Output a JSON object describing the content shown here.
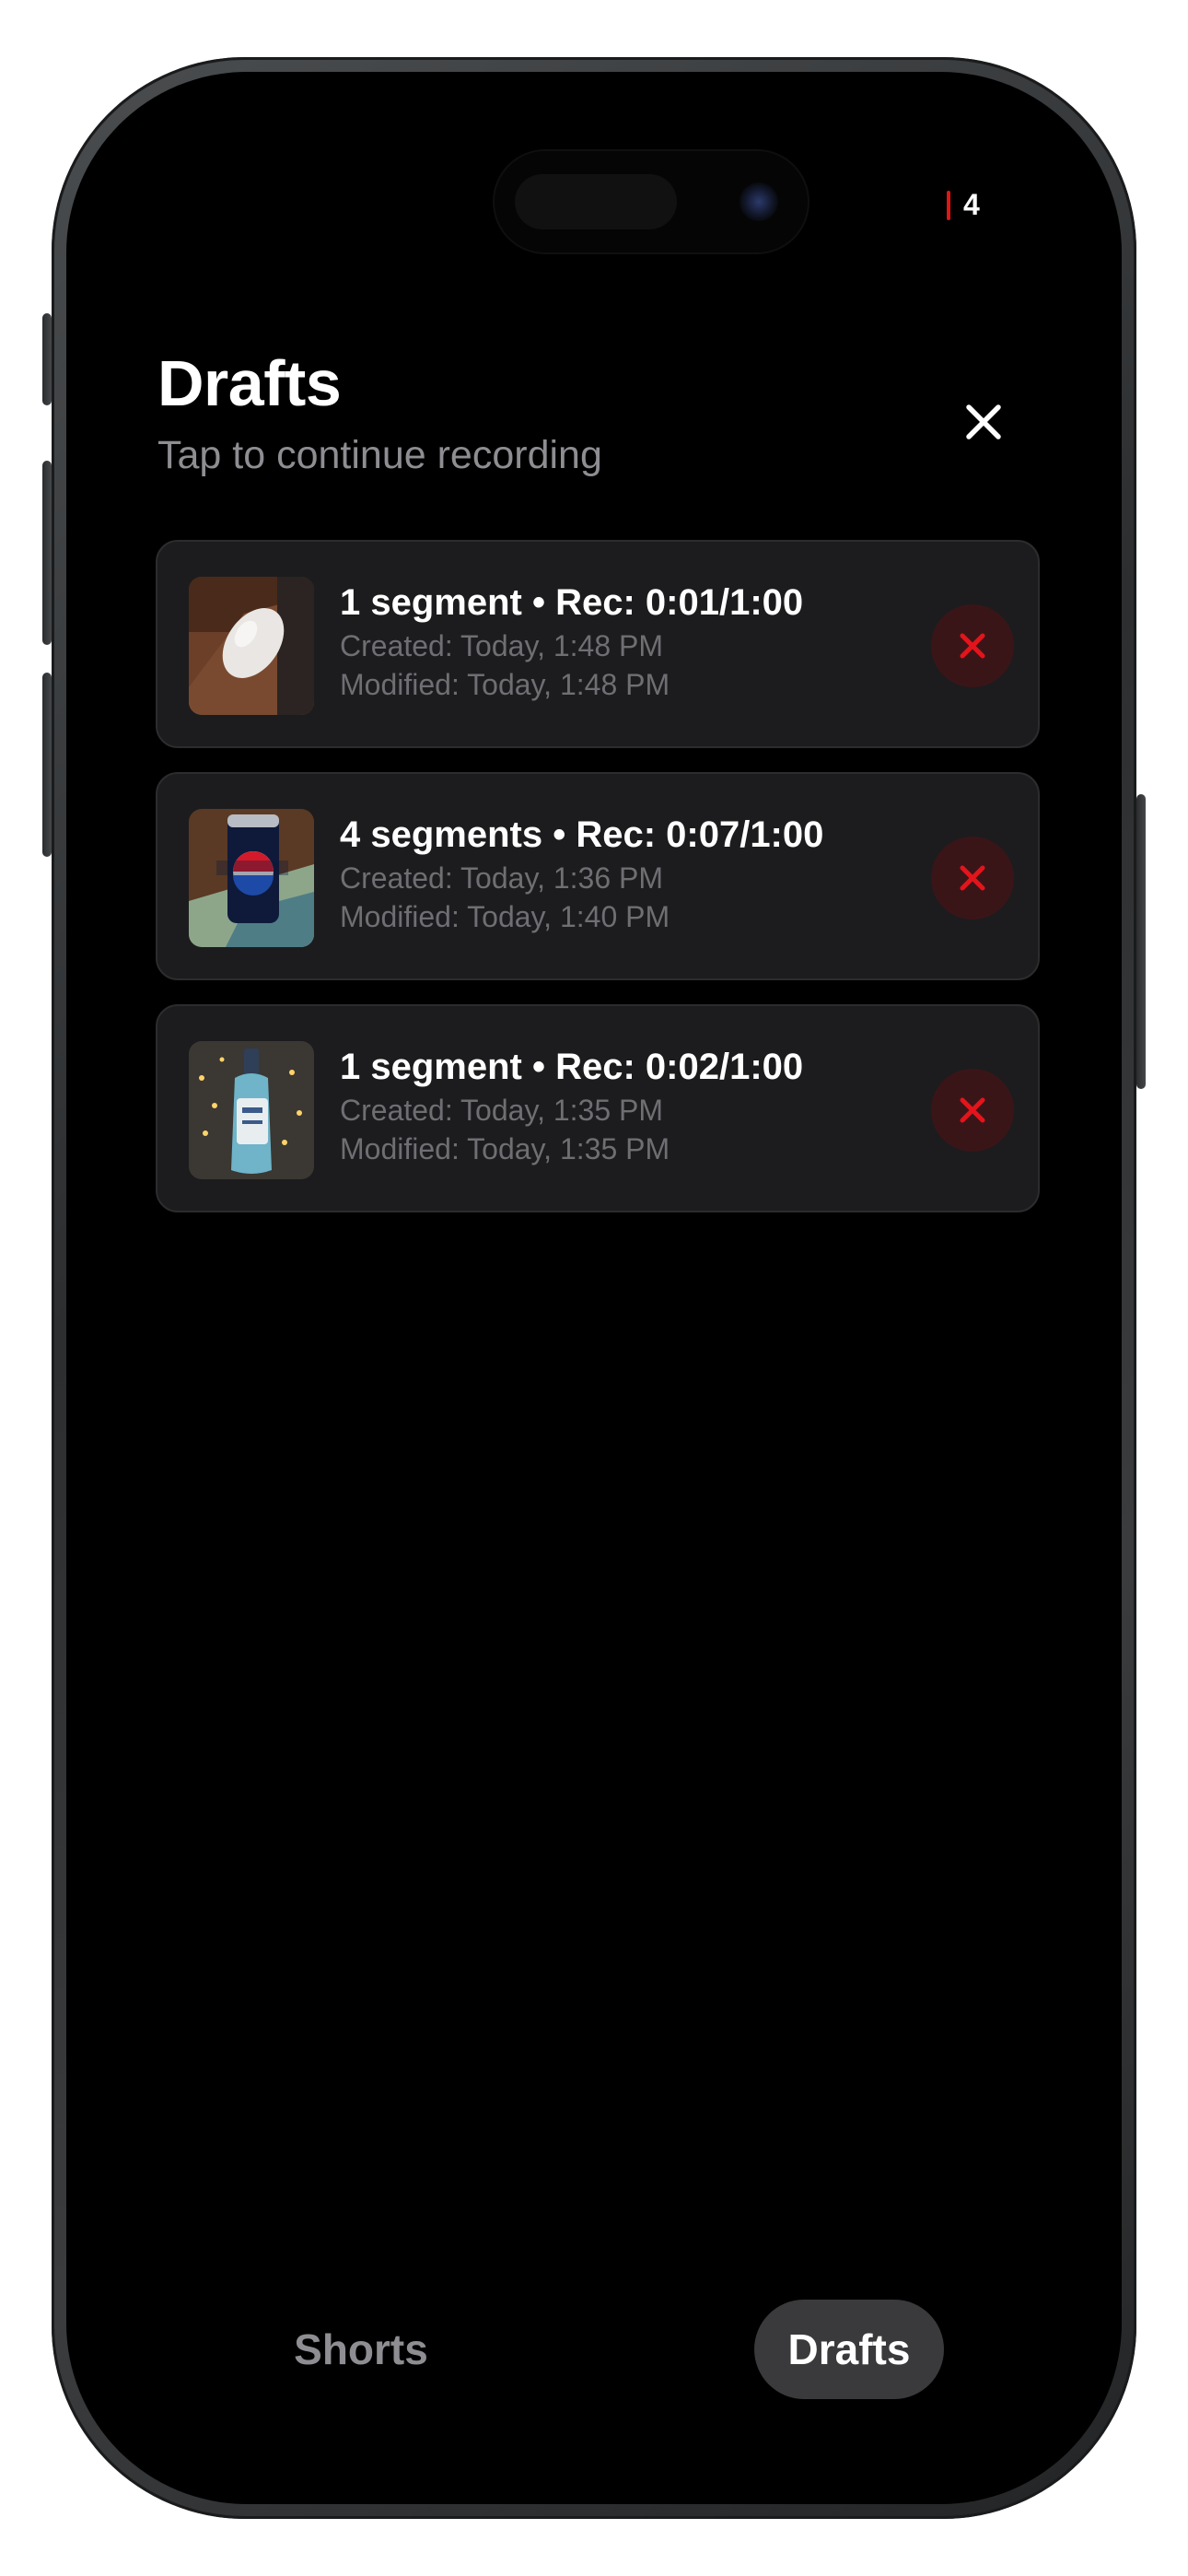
{
  "status": {
    "recording_count": "4"
  },
  "header": {
    "title": "Drafts",
    "subtitle": "Tap to continue recording"
  },
  "drafts": [
    {
      "title": "1 segment • Rec: 0:01/1:00",
      "created": "Created: Today, 1:48 PM",
      "modified": "Modified: Today, 1:48 PM",
      "thumbnail": "white computer mouse on desk"
    },
    {
      "title": "4 segments • Rec: 0:07/1:00",
      "created": "Created: Today, 1:36 PM",
      "modified": "Modified: Today, 1:40 PM",
      "thumbnail": "Pepsi can on table"
    },
    {
      "title": "1 segment • Rec: 0:02/1:00",
      "created": "Created: Today, 1:35 PM",
      "modified": "Modified: Today, 1:35 PM",
      "thumbnail": "gin bottle with string lights"
    }
  ],
  "tabs": [
    {
      "label": "Shorts",
      "selected": false
    },
    {
      "label": "Drafts",
      "selected": true
    }
  ],
  "icons": {
    "close": "close-icon",
    "delete": "delete-x-icon"
  },
  "colors": {
    "background": "#000000",
    "card": "#1c1c1e",
    "delete_accent": "#e3141b",
    "subtitle": "#8d8d92"
  }
}
